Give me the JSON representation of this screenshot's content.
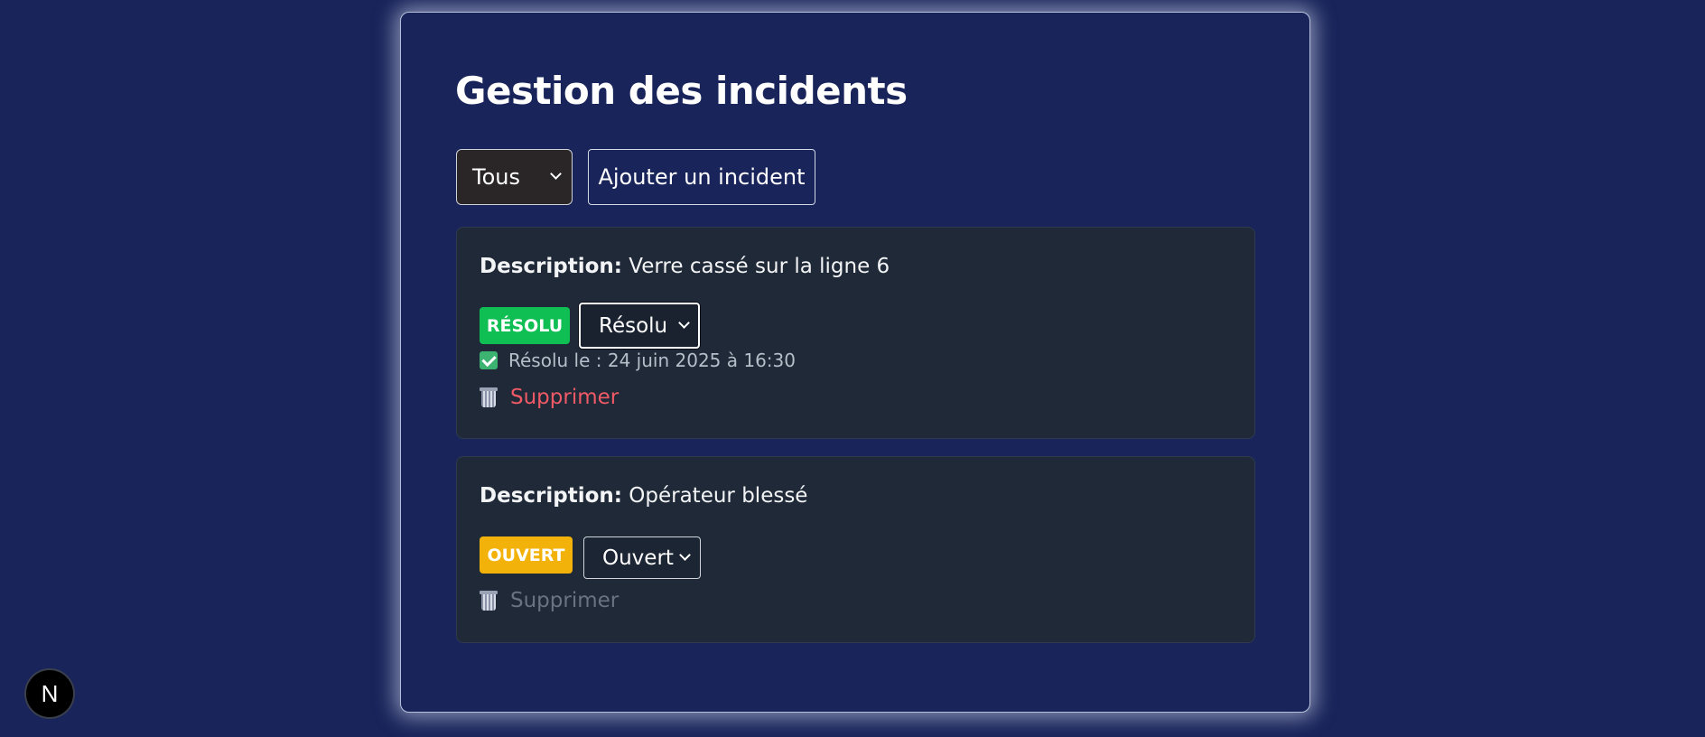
{
  "page": {
    "title": "Gestion des incidents",
    "filter": {
      "selected": "Tous"
    },
    "add_button_label": "Ajouter un incident"
  },
  "incidents": [
    {
      "description_label": "Description:",
      "description": "Verre cassé sur la ligne 6",
      "badge": "RÉSOLU",
      "badge_color": "#0fbf53",
      "status_selected": "Résolu",
      "resolved_text": "Résolu le : 24 juin 2025 à 16:30",
      "resolved_icon": "check-box-icon",
      "delete_label": "Supprimer",
      "delete_icon": "trash-icon",
      "delete_enabled": true
    },
    {
      "description_label": "Description:",
      "description": "Opérateur blessé",
      "badge": "OUVERT",
      "badge_color": "#f2b20a",
      "status_selected": "Ouvert",
      "delete_label": "Supprimer",
      "delete_icon": "trash-icon",
      "delete_enabled": false
    }
  ],
  "dev_badge": {
    "label": "N"
  },
  "colors": {
    "background": "#18245a",
    "card": "#1f2937",
    "delete_active": "#f05a66",
    "delete_disabled": "#6b7280"
  }
}
